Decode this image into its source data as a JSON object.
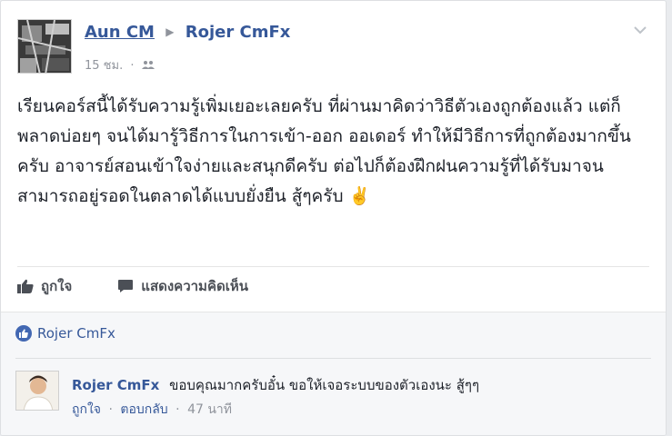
{
  "post": {
    "author": "Aun CM",
    "target": "Rojer CmFx",
    "time": "15 ชม.",
    "privacy_icon": "friends-icon",
    "text": "เรียนคอร์สนี้ได้รับความรู้เพิ่มเยอะเลยครับ ที่ผ่านมาคิดว่าวิธีตัวเองถูกต้องแล้ว แต่ก็พลาดบ่อยๆ จนได้มารู้วิธีการในการเข้า-ออก ออเดอร์ ทำให้มีวิธีการที่ถูกต้องมากขึ้นครับ อาจารย์สอนเข้าใจง่ายและสนุกดีครับ ต่อไปก็ต้องฝึกฝนความรู้ที่ได้รับมาจนสามารถอยู่รอดในตลาดได้แบบยั่งยืน สู้ๆครับ ✌️"
  },
  "actions": {
    "like_label": "ถูกใจ",
    "comment_label": "แสดงความคิดเห็น"
  },
  "reactions": {
    "liker": "Rojer CmFx"
  },
  "comment": {
    "author": "Rojer CmFx",
    "text": "ขอบคุณมากครับอั๋น ขอให้เจอระบบของตัวเองนะ สู้ๆๆ",
    "like_label": "ถูกใจ",
    "reply_label": "ตอบกลับ",
    "time": "47 นาที"
  },
  "colors": {
    "link": "#365899",
    "meta": "#90949c",
    "like_bubble": "#4267b2"
  }
}
